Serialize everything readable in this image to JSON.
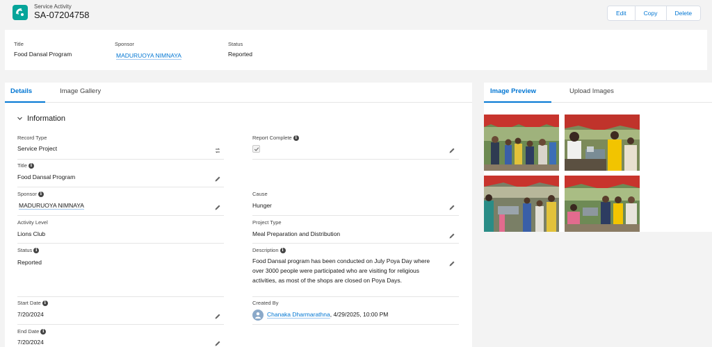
{
  "header": {
    "object_type": "Service Activity",
    "record_name": "SA-07204758",
    "icon": "service-activity-icon",
    "buttons": {
      "edit": "Edit",
      "copy": "Copy",
      "delete": "Delete"
    }
  },
  "highlights": {
    "title_label": "Title",
    "title_value": "Food Dansal Program",
    "sponsor_label": "Sponsor",
    "sponsor_value": "MADURUOYA NIMNAYA",
    "status_label": "Status",
    "status_value": "Reported"
  },
  "details": {
    "tabs": {
      "details": "Details",
      "gallery": "Image Gallery"
    },
    "section_title": "Information",
    "fields": {
      "record_type_label": "Record Type",
      "record_type_value": "Service Project",
      "title_label": "Title",
      "title_value": "Food Dansal Program",
      "sponsor_label": "Sponsor",
      "sponsor_value": "MADURUOYA NIMNAYA",
      "activity_level_label": "Activity Level",
      "activity_level_value": "Lions Club",
      "status_label": "Status",
      "status_value": "Reported",
      "start_date_label": "Start Date",
      "start_date_value": "7/20/2024",
      "end_date_label": "End Date",
      "end_date_value": "7/20/2024",
      "report_complete_label": "Report Complete",
      "report_complete_checked": true,
      "cause_label": "Cause",
      "cause_value": "Hunger",
      "project_type_label": "Project Type",
      "project_type_value": "Meal Preparation and Distribution",
      "description_label": "Description",
      "description_value": "Food Dansal program has been conducted on July Poya Day where over 3000 people were participated who are visiting for religious activities, as most of the shops are closed on Poya Days.",
      "created_by_label": "Created By",
      "created_by_name": "Chanaka Dharmarathna",
      "created_by_date": ", 4/29/2025, 10:00 PM"
    }
  },
  "images": {
    "tabs": {
      "preview": "Image Preview",
      "upload": "Upload Images"
    }
  },
  "colors": {
    "brand_icon": "#06a59a",
    "accent": "#0176d3"
  }
}
